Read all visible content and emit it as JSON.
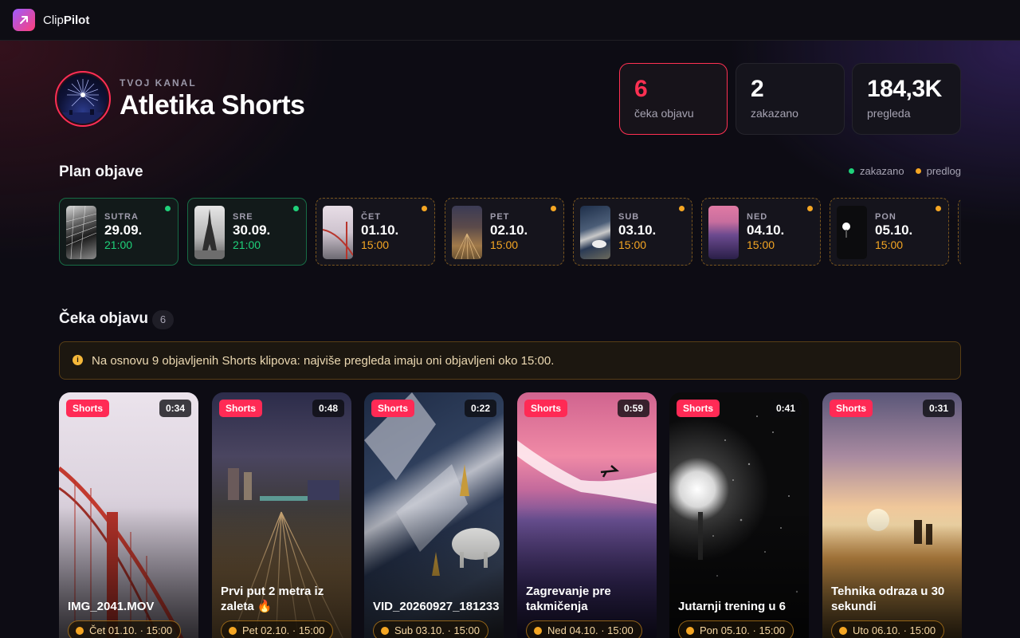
{
  "app": {
    "name_light": "Clip",
    "name_bold": "Pilot",
    "logo_icon": "arrow-up-right-icon"
  },
  "channel": {
    "kicker": "TVOJ KANAL",
    "name": "Atletika Shorts"
  },
  "stats": [
    {
      "value": "6",
      "label": "čeka objavu",
      "active": true
    },
    {
      "value": "2",
      "label": "zakazano",
      "active": false
    },
    {
      "value": "184,3K",
      "label": "pregleda",
      "active": false
    }
  ],
  "plan": {
    "title": "Plan objave",
    "legend": {
      "scheduled": "zakazano",
      "proposal": "predlog"
    },
    "colors": {
      "scheduled": "#1fd17a",
      "proposal": "#f5a623"
    },
    "items": [
      {
        "day": "SUTRA",
        "date": "29.09.",
        "time": "21:00",
        "status": "scheduled"
      },
      {
        "day": "SRE",
        "date": "30.09.",
        "time": "21:00",
        "status": "scheduled"
      },
      {
        "day": "ČET",
        "date": "01.10.",
        "time": "15:00",
        "status": "proposal"
      },
      {
        "day": "PET",
        "date": "02.10.",
        "time": "15:00",
        "status": "proposal"
      },
      {
        "day": "SUB",
        "date": "03.10.",
        "time": "15:00",
        "status": "proposal"
      },
      {
        "day": "NED",
        "date": "04.10.",
        "time": "15:00",
        "status": "proposal"
      },
      {
        "day": "PON",
        "date": "05.10.",
        "time": "15:00",
        "status": "proposal"
      }
    ]
  },
  "waiting": {
    "title": "Čeka objavu",
    "count": "6",
    "insight": "Na osnovu 9 objavljenih Shorts klipova: najviše pregleda imaju oni objavljeni oko 15:00.",
    "clips": [
      {
        "tag": "Shorts",
        "duration": "0:34",
        "title": "IMG_2041.MOV",
        "when": "Čet 01.10. · 15:00"
      },
      {
        "tag": "Shorts",
        "duration": "0:48",
        "title": "Prvi put 2 metra iz zaleta 🔥",
        "when": "Pet 02.10. · 15:00"
      },
      {
        "tag": "Shorts",
        "duration": "0:22",
        "title": "VID_20260927_181233",
        "when": "Sub 03.10. · 15:00"
      },
      {
        "tag": "Shorts",
        "duration": "0:59",
        "title": "Zagrevanje pre takmičenja",
        "when": "Ned 04.10. · 15:00"
      },
      {
        "tag": "Shorts",
        "duration": "0:41",
        "title": "Jutarnji trening u 6",
        "when": "Pon 05.10. · 15:00"
      },
      {
        "tag": "Shorts",
        "duration": "0:31",
        "title": "Tehnika odraza u 30 sekundi",
        "when": "Uto 06.10. · 15:00"
      }
    ]
  }
}
